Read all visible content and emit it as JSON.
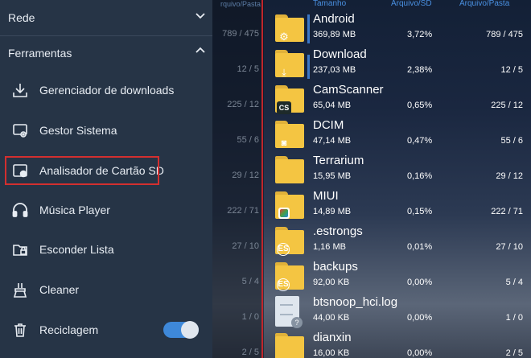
{
  "drawer": {
    "sections": [
      {
        "label": "Rede",
        "expanded": false
      },
      {
        "label": "Ferramentas",
        "expanded": true
      }
    ],
    "items": [
      {
        "label": "Gerenciador de downloads",
        "icon": "download-icon"
      },
      {
        "label": "Gestor Sistema",
        "icon": "system-manager-icon"
      },
      {
        "label": "Analisador de Cartão SD",
        "icon": "sd-analyzer-icon"
      },
      {
        "label": "Música Player",
        "icon": "headphones-icon"
      },
      {
        "label": "Esconder Lista",
        "icon": "hidden-list-icon"
      },
      {
        "label": "Cleaner",
        "icon": "cleaner-icon"
      },
      {
        "label": "Reciclagem",
        "icon": "trash-icon"
      }
    ],
    "recycle_toggle": true
  },
  "middle_pane": {
    "header": "rquivo/Pasta",
    "values": [
      "789 / 475",
      "12 / 5",
      "225 / 12",
      "55 / 6",
      "29 / 12",
      "222 / 71",
      "27 / 10",
      "5 / 4",
      "1 / 0",
      "2 / 5"
    ]
  },
  "files": {
    "headers": {
      "size": "Tamanho",
      "pct": "Arquivo/SD",
      "count": "Arquivo/Pasta"
    },
    "rows": [
      {
        "name": "Android",
        "size": "369,89 MB",
        "pct": "3,72%",
        "count": "789 / 475",
        "icon": "gear-folder-icon"
      },
      {
        "name": "Download",
        "size": "237,03 MB",
        "pct": "2,38%",
        "count": "12 / 5",
        "icon": "download-folder-icon"
      },
      {
        "name": "CamScanner",
        "size": "65,04 MB",
        "pct": "0,65%",
        "count": "225 / 12",
        "icon": "camscanner-folder-icon"
      },
      {
        "name": "DCIM",
        "size": "47,14 MB",
        "pct": "0,47%",
        "count": "55 / 6",
        "icon": "camera-folder-icon"
      },
      {
        "name": "Terrarium",
        "size": "15,95 MB",
        "pct": "0,16%",
        "count": "29 / 12",
        "icon": "folder-icon"
      },
      {
        "name": "MIUI",
        "size": "14,89 MB",
        "pct": "0,15%",
        "count": "222 / 71",
        "icon": "miui-folder-icon"
      },
      {
        "name": ".estrongs",
        "size": "1,16 MB",
        "pct": "0,01%",
        "count": "27 / 10",
        "icon": "es-folder-icon"
      },
      {
        "name": "backups",
        "size": "92,00 KB",
        "pct": "0,00%",
        "count": "5 / 4",
        "icon": "es-folder-icon"
      },
      {
        "name": "btsnoop_hci.log",
        "size": "44,00 KB",
        "pct": "0,00%",
        "count": "1 / 0",
        "icon": "unknown-file-icon"
      },
      {
        "name": "dianxin",
        "size": "16,00 KB",
        "pct": "0,00%",
        "count": "2 / 5",
        "icon": "folder-icon"
      }
    ]
  }
}
